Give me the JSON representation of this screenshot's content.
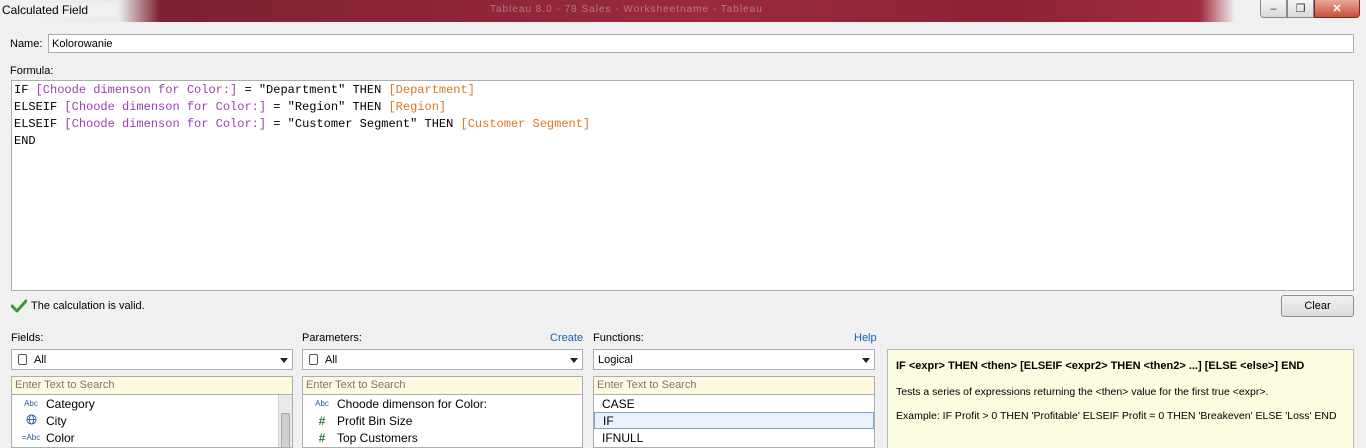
{
  "window": {
    "title": "Calculated Field",
    "background_text": "Tableau 8.0 - 78 Sales - Worksheetname - Tableau"
  },
  "name": {
    "label": "Name:",
    "value": "Kolorowanie"
  },
  "formula": {
    "label": "Formula:",
    "lines": [
      [
        {
          "t": "IF ",
          "c": "kw"
        },
        {
          "t": "[Choode dimenson for Color:]",
          "c": "param"
        },
        {
          "t": " = \"Department\" THEN ",
          "c": "str"
        },
        {
          "t": "[Department]",
          "c": "field"
        }
      ],
      [
        {
          "t": "ELSEIF ",
          "c": "kw"
        },
        {
          "t": "[Choode dimenson for Color:]",
          "c": "param"
        },
        {
          "t": " = \"Region\" THEN ",
          "c": "str"
        },
        {
          "t": "[Region]",
          "c": "field"
        }
      ],
      [
        {
          "t": "ELSEIF ",
          "c": "kw"
        },
        {
          "t": "[Choode dimenson for Color:]",
          "c": "param"
        },
        {
          "t": " = \"Customer Segment\" THEN ",
          "c": "str"
        },
        {
          "t": "[Customer Segment]",
          "c": "field"
        }
      ],
      [
        {
          "t": "END",
          "c": "kw"
        }
      ]
    ]
  },
  "status": {
    "text": "The calculation is valid.",
    "icon": "check-icon",
    "color": "#3a9a3a"
  },
  "clear_button": "Clear",
  "fields": {
    "label": "Fields:",
    "dropdown": "All",
    "search_placeholder": "Enter Text to Search",
    "items": [
      {
        "icon": "Abc",
        "label": "Category"
      },
      {
        "icon": "globe",
        "label": "City"
      },
      {
        "icon": "=Abc",
        "label": "Color"
      }
    ]
  },
  "parameters": {
    "label": "Parameters:",
    "link": "Create",
    "dropdown": "All",
    "search_placeholder": "Enter Text to Search",
    "items": [
      {
        "icon": "Abc",
        "label": "Choode dimenson for Color:"
      },
      {
        "icon": "#",
        "label": "Profit Bin Size"
      },
      {
        "icon": "#",
        "label": "Top Customers"
      }
    ]
  },
  "functions": {
    "label": "Functions:",
    "link": "Help",
    "dropdown": "Logical",
    "search_placeholder": "Enter Text to Search",
    "items": [
      {
        "label": "CASE",
        "selected": false
      },
      {
        "label": "IF",
        "selected": true
      },
      {
        "label": "IFNULL",
        "selected": false
      }
    ]
  },
  "help_panel": {
    "syntax": "IF <expr> THEN <then> [ELSEIF <expr2> THEN <then2> ...] [ELSE <else>] END",
    "description": "Tests a series of expressions returning the <then> value for the first true <expr>.",
    "example": "Example: IF Profit > 0 THEN 'Profitable' ELSEIF Profit = 0 THEN 'Breakeven' ELSE 'Loss' END"
  }
}
